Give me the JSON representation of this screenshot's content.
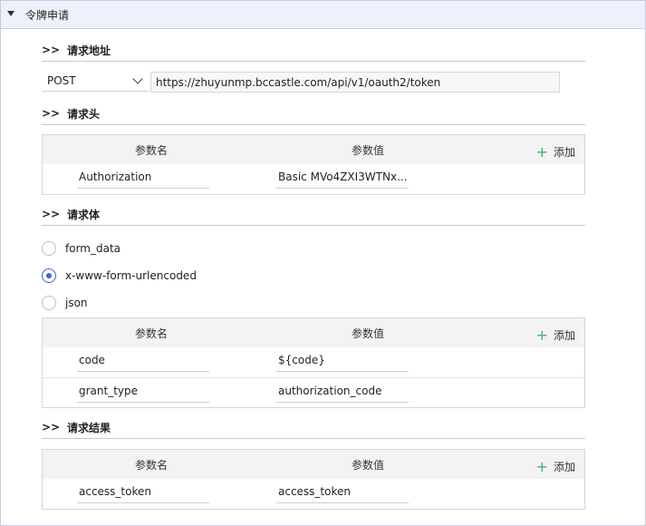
{
  "panel": {
    "title": "令牌申请"
  },
  "sections": {
    "address": {
      "arrows": ">>",
      "title": "请求地址"
    },
    "headers": {
      "arrows": ">>",
      "title": "请求头"
    },
    "body": {
      "arrows": ">>",
      "title": "请求体"
    },
    "result": {
      "arrows": ">>",
      "title": "请求结果"
    }
  },
  "request": {
    "method": "POST",
    "url": "https://zhuyunmp.bccastle.com/api/v1/oauth2/token"
  },
  "table_labels": {
    "name": "参数名",
    "value": "参数值",
    "add": "添加"
  },
  "headers_rows": [
    {
      "name": "Authorization",
      "value": "Basic MVo4ZXI3WTNx..."
    }
  ],
  "body_types": [
    {
      "label": "form_data",
      "checked": false
    },
    {
      "label": "x-www-form-urlencoded",
      "checked": true
    },
    {
      "label": "json",
      "checked": false
    }
  ],
  "body_rows": [
    {
      "name": "code",
      "value": "${code}"
    },
    {
      "name": "grant_type",
      "value": "authorization_code"
    }
  ],
  "result_rows": [
    {
      "name": "access_token",
      "value": "access_token"
    }
  ],
  "colors": {
    "accent": "#3b63d9",
    "add_icon": "#3db36a",
    "header_bg": "#eef0fb"
  }
}
